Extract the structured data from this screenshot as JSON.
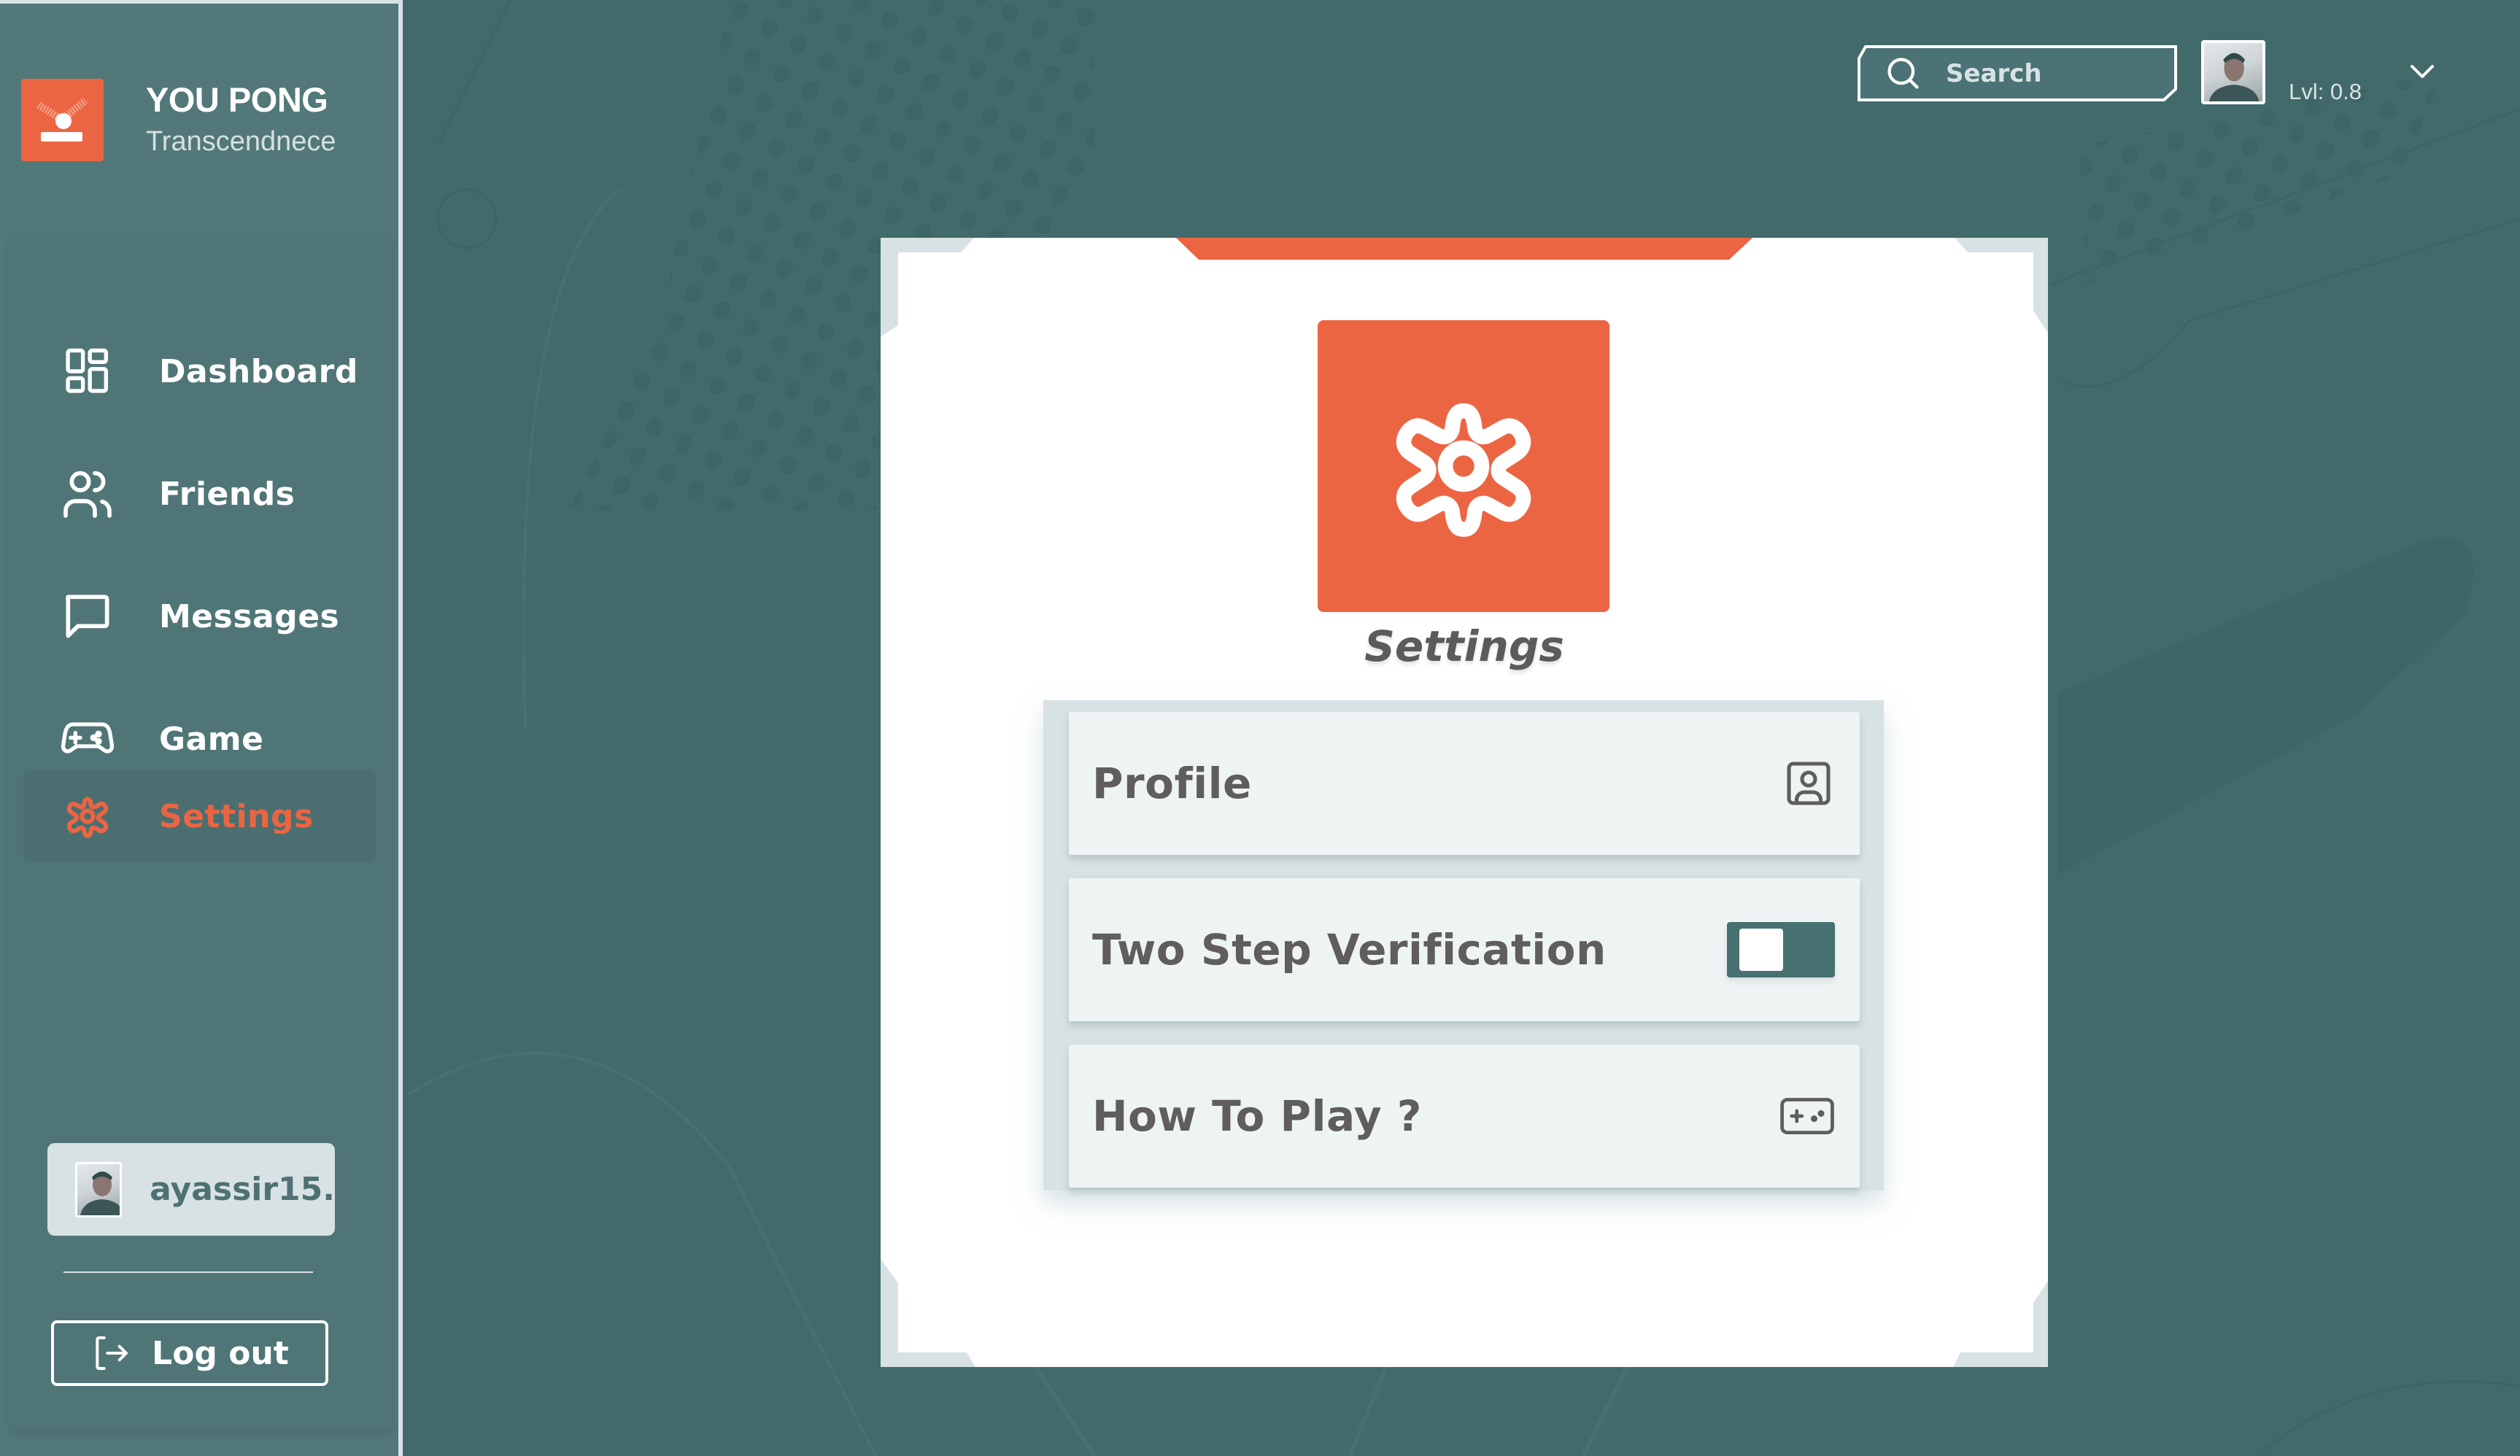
{
  "app": {
    "brand_title": "YOU PONG",
    "brand_subtitle": "Transcendnece",
    "accent_color": "#ec6542",
    "background_color": "#436a6a"
  },
  "sidebar": {
    "items": [
      {
        "label": "Dashboard",
        "icon": "dashboard-grid-icon",
        "active": false
      },
      {
        "label": "Friends",
        "icon": "users-icon",
        "active": false
      },
      {
        "label": "Messages",
        "icon": "message-square-icon",
        "active": false
      },
      {
        "label": "Game",
        "icon": "gamepad-icon",
        "active": false
      },
      {
        "label": "Settings",
        "icon": "gear-icon",
        "active": true
      }
    ],
    "user": {
      "username": "ayassir15.",
      "avatar": "user-avatar-photo"
    },
    "logout_label": "Log out"
  },
  "topbar": {
    "search_placeholder": "Search",
    "search_value": "",
    "level_text": "Lvl: 0.8"
  },
  "settings": {
    "title": "Settings",
    "rows": [
      {
        "label": "Profile",
        "icon": "profile-card-icon"
      },
      {
        "label": "Two Step Verification",
        "control": "toggle",
        "enabled": false
      },
      {
        "label": "How To Play ?",
        "icon": "gamepad-icon"
      }
    ]
  }
}
